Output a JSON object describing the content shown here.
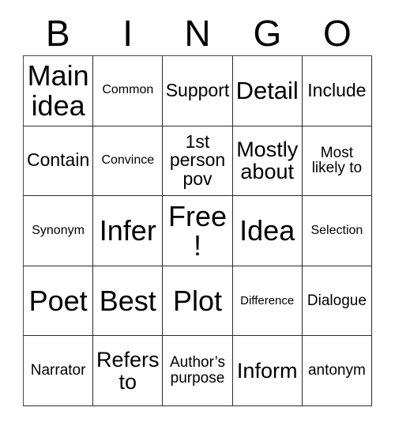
{
  "card": {
    "title": "BINGO",
    "header": {
      "letters": [
        "B",
        "I",
        "N",
        "G",
        "O"
      ]
    },
    "grid": {
      "columns": 5,
      "rows": 5,
      "free_space": {
        "row": 3,
        "column": 3,
        "label": "Free!"
      },
      "cells": [
        {
          "text": "Main idea",
          "size": "xxl",
          "row": 1,
          "column": 1
        },
        {
          "text": "Common",
          "size": "xs",
          "row": 1,
          "column": 2
        },
        {
          "text": "Support",
          "size": "md",
          "row": 1,
          "column": 3
        },
        {
          "text": "Detail",
          "size": "xl",
          "row": 1,
          "column": 4
        },
        {
          "text": "Include",
          "size": "md",
          "row": 1,
          "column": 5
        },
        {
          "text": "Contain",
          "size": "md",
          "row": 2,
          "column": 1
        },
        {
          "text": "Convince",
          "size": "xs",
          "row": 2,
          "column": 2
        },
        {
          "text": "1st person pov",
          "size": "md",
          "row": 2,
          "column": 3
        },
        {
          "text": "Mostly about",
          "size": "lg",
          "row": 2,
          "column": 4
        },
        {
          "text": "Most likely to",
          "size": "sm",
          "row": 2,
          "column": 5
        },
        {
          "text": "Synonym",
          "size": "xs",
          "row": 3,
          "column": 1
        },
        {
          "text": "Infer",
          "size": "xxl",
          "row": 3,
          "column": 2
        },
        {
          "text": "Free!",
          "size": "xxl",
          "row": 3,
          "column": 3
        },
        {
          "text": "Idea",
          "size": "xxl",
          "row": 3,
          "column": 4
        },
        {
          "text": "Selection",
          "size": "xs",
          "row": 3,
          "column": 5
        },
        {
          "text": "Poet",
          "size": "xxl",
          "row": 4,
          "column": 1
        },
        {
          "text": "Best",
          "size": "xxl",
          "row": 4,
          "column": 2
        },
        {
          "text": "Plot",
          "size": "xxl",
          "row": 4,
          "column": 3
        },
        {
          "text": "Difference",
          "size": "xxs",
          "row": 4,
          "column": 4
        },
        {
          "text": "Dialogue",
          "size": "sm",
          "row": 4,
          "column": 5
        },
        {
          "text": "Narrator",
          "size": "sm",
          "row": 5,
          "column": 1
        },
        {
          "text": "Refers to",
          "size": "lg",
          "row": 5,
          "column": 2
        },
        {
          "text": "Author’s purpose",
          "size": "sm",
          "row": 5,
          "column": 3
        },
        {
          "text": "Inform",
          "size": "lg",
          "row": 5,
          "column": 4
        },
        {
          "text": "antonym",
          "size": "sm",
          "row": 5,
          "column": 5
        }
      ]
    },
    "colors": {
      "background": "#ffffff",
      "text": "#000000",
      "grid_line": "#2b2b2b"
    }
  }
}
